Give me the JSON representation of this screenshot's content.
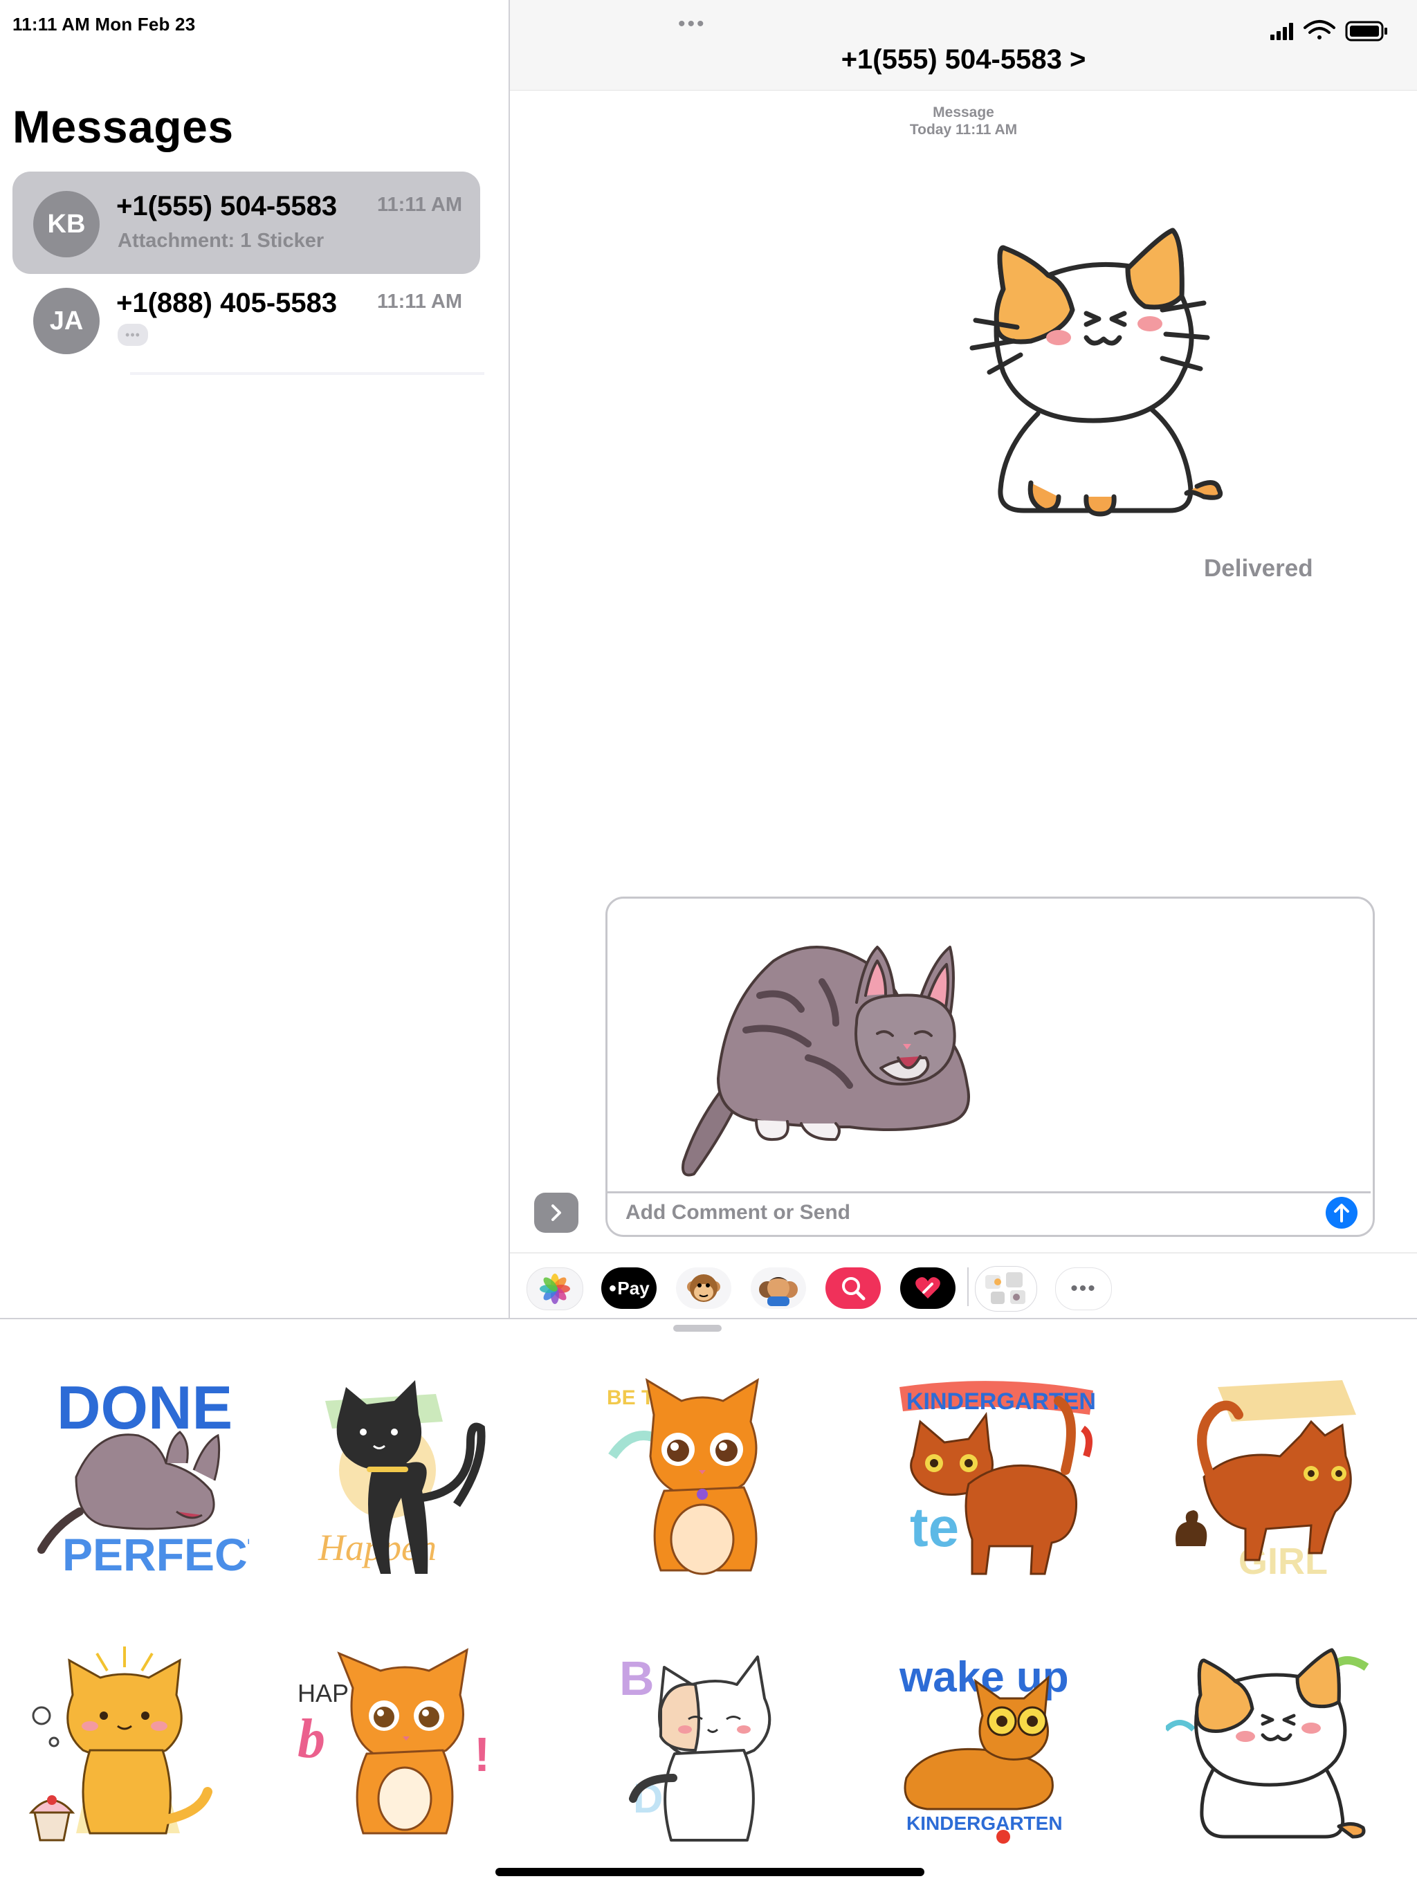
{
  "status_bar": {
    "time_date": "11:11 AM  Mon Feb 23"
  },
  "sidebar": {
    "title": "Messages",
    "conversations": [
      {
        "initials": "KB",
        "name": "+1(555) 504-5583",
        "time": "11:11 AM",
        "preview": "Attachment: 1 Sticker",
        "selected": true
      },
      {
        "initials": "JA",
        "name": "+1(888) 405-5583",
        "time": "11:11 AM",
        "preview": "",
        "selected": false
      }
    ]
  },
  "chat": {
    "contact_title": "+1(555) 504-5583 >",
    "meta_label": "Message",
    "meta_time": "Today 11:11 AM",
    "received_sticker": "calico-cat-sticker",
    "delivered_label": "Delivered"
  },
  "compose": {
    "attached_sticker": "tabby-cat-sticker",
    "placeholder": "Add Comment or Send",
    "send_color": "#0a7aff"
  },
  "app_strip": {
    "apple_pay_label": "Pay",
    "items": [
      "photos-icon",
      "apple-pay-icon",
      "animoji-icon",
      "memoji-icon",
      "search-images-icon",
      "digital-touch-icon",
      "cat-stickers-app-icon",
      "more-apps-icon"
    ]
  },
  "sticker_grid": {
    "row1": [
      {
        "name": "sticker-done-perfect",
        "caption_top": "DONE",
        "caption_bottom": "PERFECT"
      },
      {
        "name": "sticker-black-cat-happen",
        "caption_bottom": "Happen"
      },
      {
        "name": "sticker-orange-kitten",
        "caption_top": "BE TH"
      },
      {
        "name": "sticker-kindergarten-cat",
        "caption_top": "KINDERGARTEN"
      },
      {
        "name": "sticker-brown-cat-poo",
        "caption_bottom": "GIRL"
      }
    ],
    "row2": [
      {
        "name": "sticker-yellow-cat-cupcake"
      },
      {
        "name": "sticker-orange-kitten-birthday",
        "caption_top": "HAP"
      },
      {
        "name": "sticker-white-cat"
      },
      {
        "name": "sticker-wake-up-kindergarten",
        "caption_top": "wake up",
        "caption_bottom": "KINDERGARTEN"
      },
      {
        "name": "sticker-calico-cat"
      }
    ]
  }
}
